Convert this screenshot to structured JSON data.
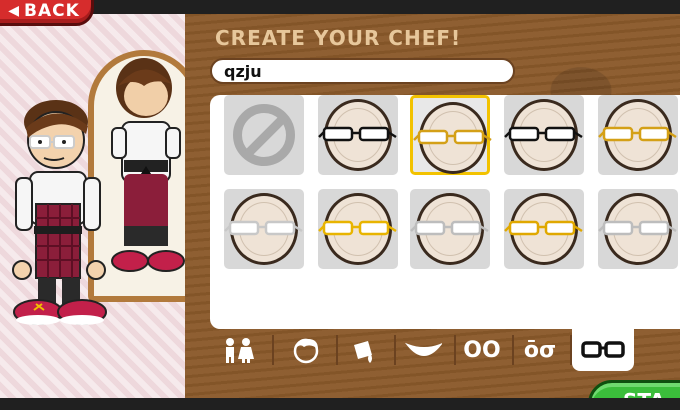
{
  "header": {
    "back_label": "BACK",
    "title": "CREATE YOUR CHEF!"
  },
  "name_field": {
    "value": "qzju"
  },
  "glasses_items": [
    {
      "kind": "none"
    },
    {
      "kind": "glasses",
      "frame_color": "#111111"
    },
    {
      "kind": "glasses",
      "frame_color": "#d4a017",
      "selected": true
    },
    {
      "kind": "glasses",
      "frame_color": "#111111"
    },
    {
      "kind": "glasses",
      "frame_color": "#d4a017"
    },
    {
      "kind": "glasses",
      "frame_color": "#c8c8c8"
    },
    {
      "kind": "glasses",
      "frame_color": "#e8b400"
    },
    {
      "kind": "glasses",
      "frame_color": "#bdbdbd"
    },
    {
      "kind": "glasses",
      "frame_color": "#e0a800"
    },
    {
      "kind": "glasses",
      "frame_color": "#bdbdbd"
    }
  ],
  "tabs": [
    {
      "icon": "people-icon"
    },
    {
      "icon": "hair-icon"
    },
    {
      "icon": "paint-bucket-icon"
    },
    {
      "icon": "smile-icon"
    },
    {
      "icon": "eyes-icon",
      "text": "OO"
    },
    {
      "icon": "eyebrows-icon",
      "text": "ōσ"
    },
    {
      "icon": "glasses-icon",
      "active": true
    }
  ],
  "footer": {
    "start_label": "STA"
  },
  "colors": {
    "wood": "#8b5a2b",
    "title": "#e7c79b",
    "back_button": "#d62c2c",
    "start_button": "#3bbd3b",
    "selected_outline": "#f2c200"
  }
}
